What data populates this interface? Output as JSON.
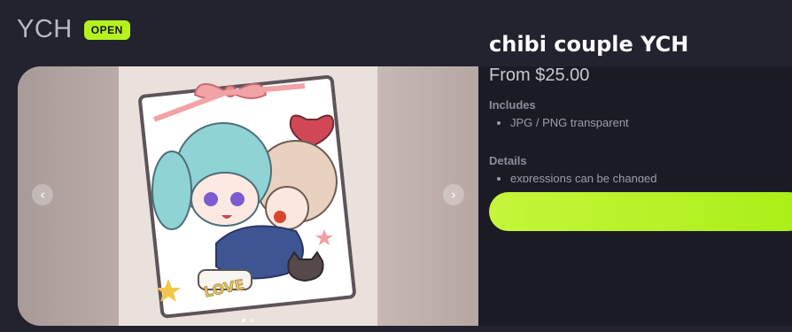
{
  "header": {
    "title": "YCH",
    "status_badge": "OPEN"
  },
  "product": {
    "name": "chibi couple YCH",
    "price": "From $25.00",
    "includes_label": "Includes",
    "includes": [
      "JPG / PNG transparent"
    ],
    "details_label": "Details",
    "details": [
      "expressions can be changed"
    ]
  },
  "gallery": {
    "prev_icon": "‹",
    "next_icon": "›",
    "slide_count": 2,
    "active_slide": 1,
    "art_text": "LOVE"
  },
  "colors": {
    "accent": "#b5f21f",
    "background": "#22232f"
  }
}
